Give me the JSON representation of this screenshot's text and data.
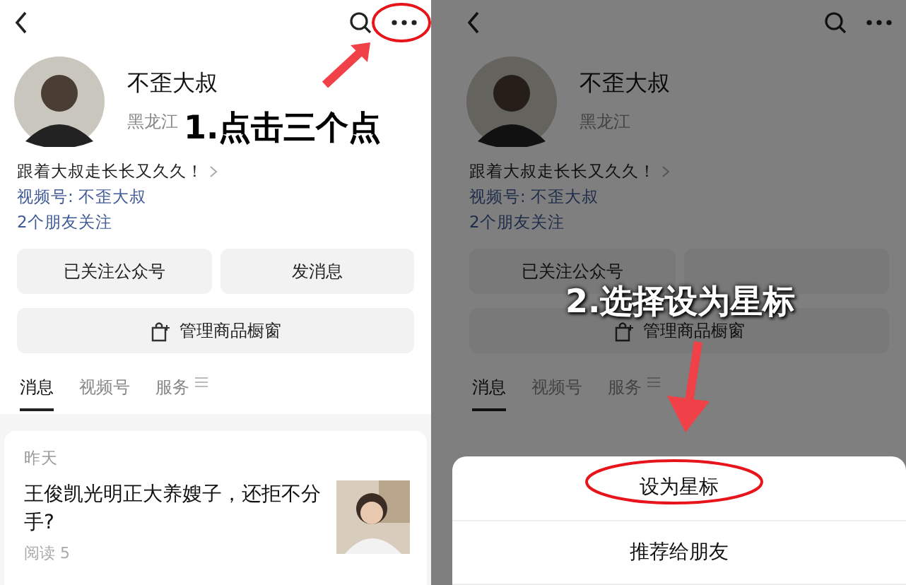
{
  "panels": [
    {
      "dimmed": false,
      "profile": {
        "name": "不歪大叔",
        "region": "黑龙江",
        "bio": "跟着大叔走长长又久久！",
        "channel": "视频号: 不歪大叔",
        "followers": "2个朋友关注"
      },
      "buttons": [
        {
          "kind": "text",
          "label": "已关注公众号"
        },
        {
          "kind": "text",
          "label": "发消息"
        }
      ],
      "manage": "管理商品橱窗",
      "tabs": [
        {
          "label": "消息",
          "selected": true
        },
        {
          "label": "视频号",
          "selected": false
        },
        {
          "label": "服务",
          "selected": false
        }
      ],
      "feed": {
        "date": "昨天",
        "title": "王俊凯光明正大养嫂子，还拒不分手?",
        "reads": "阅读 5"
      },
      "annotation": {
        "text": "1.点击三个点",
        "kind": "dark"
      }
    },
    {
      "dimmed": true,
      "profile": {
        "name": "不歪大叔",
        "region": "黑龙江",
        "bio": "跟着大叔走长长又久久！",
        "channel": "视频号: 不歪大叔",
        "followers": "2个朋友关注"
      },
      "buttons": [
        {
          "kind": "text",
          "label": "已关注公众号"
        },
        {
          "kind": "blank"
        }
      ],
      "manage": "管理商品橱窗",
      "tabs": [
        {
          "label": "消息",
          "selected": true
        },
        {
          "label": "视频号",
          "selected": false
        },
        {
          "label": "服务",
          "selected": false
        }
      ],
      "sheet": {
        "items": [
          "设为星标",
          "推荐给朋友"
        ]
      },
      "annotation": {
        "text": "2.选择设为星标",
        "kind": "light"
      }
    }
  ]
}
